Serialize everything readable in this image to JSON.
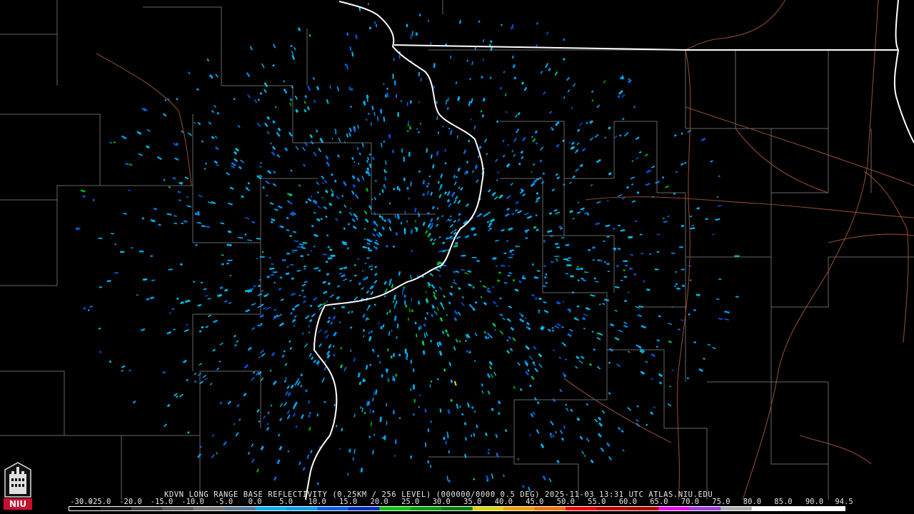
{
  "radar": {
    "station": "KDVN",
    "caption": "KDVN LONG RANGE BASE REFLECTIVITY (0.25KM / 256 LEVEL) (000000/0000 0.5 DEG) 2025-11-03 13:31 UTC  ATLAS.NIU.EDU",
    "product": "LONG RANGE BASE REFLECTIVITY",
    "timestamp": "2025-11-03 13:31 UTC",
    "source": "ATLAS.NIU.EDU"
  },
  "scale": {
    "ticks": [
      "-30.0",
      "-25.0",
      "-20.0",
      "-15.0",
      "-10.0",
      "-5.0",
      "0.0",
      "5.0",
      "10.0",
      "15.0",
      "20.0",
      "25.0",
      "30.0",
      "35.0",
      "40.0",
      "45.0",
      "50.0",
      "55.0",
      "60.0",
      "65.0",
      "70.0",
      "75.0",
      "80.0",
      "85.0",
      "90.0",
      "94.5"
    ],
    "colors": [
      "#000000",
      "#1a1a1a",
      "#3a3a3a",
      "#5a5a5a",
      "#7a7a7a",
      "#5a7a9a",
      "#00b0f0",
      "#00a0f0",
      "#0060e8",
      "#0030c0",
      "#00c800",
      "#00a000",
      "#008000",
      "#d8d800",
      "#f0a000",
      "#f07000",
      "#f00000",
      "#c00000",
      "#b00000",
      "#f000f0",
      "#a040e0",
      "#b0b0b0",
      "#ffffff",
      "#ffffff",
      "#ffffff"
    ]
  },
  "logo": {
    "text": "NIU",
    "color": "#c8102e"
  }
}
